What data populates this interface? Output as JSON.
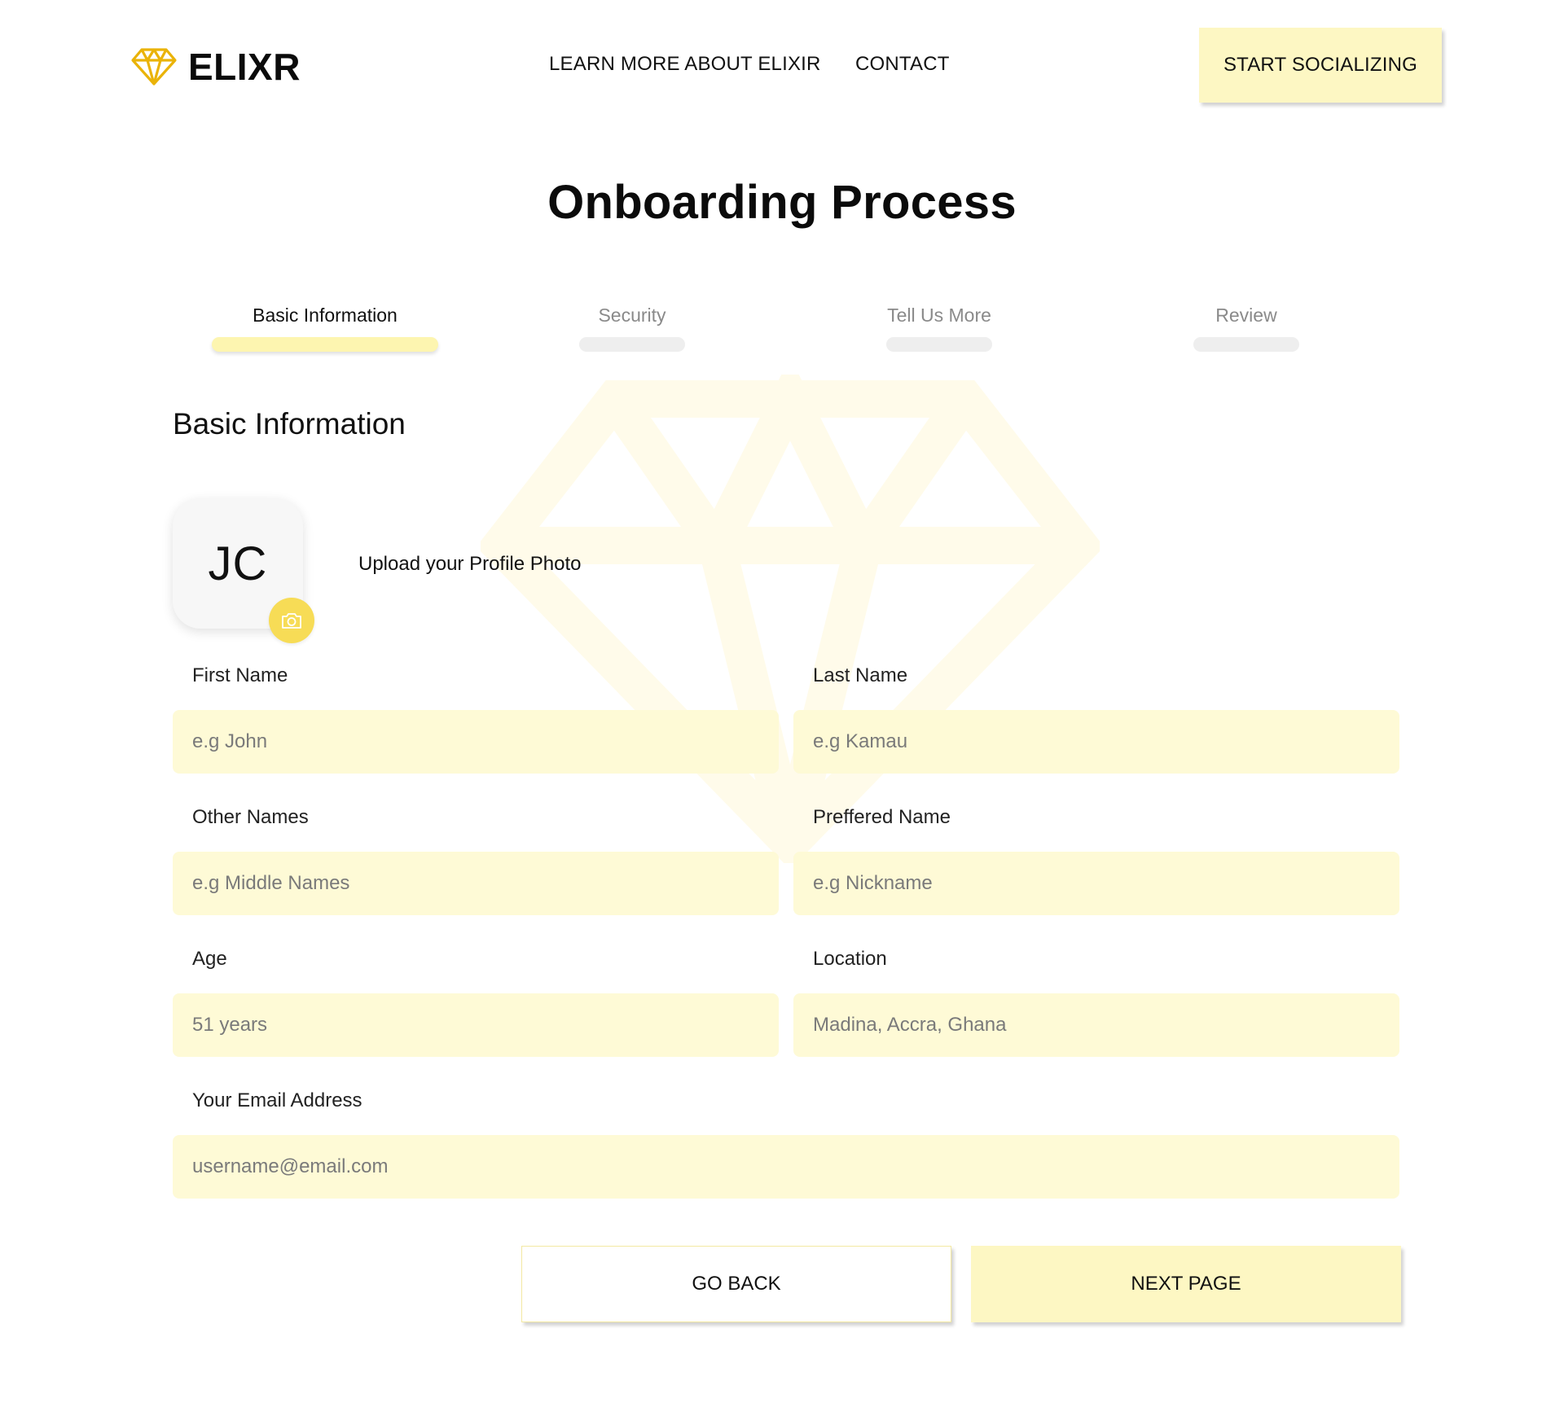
{
  "header": {
    "brand": "ELIXR",
    "brand_icon": "diamond-icon",
    "nav": {
      "learn_more": "LEARN MORE ABOUT ELIXIR",
      "contact": "CONTACT"
    },
    "cta": "START SOCIALIZING"
  },
  "title": "Onboarding Process",
  "steps": [
    {
      "label": "Basic Information",
      "active": true
    },
    {
      "label": "Security",
      "active": false
    },
    {
      "label": "Tell Us More",
      "active": false
    },
    {
      "label": "Review",
      "active": false
    }
  ],
  "section": {
    "title": "Basic Information",
    "avatar_initials": "JC",
    "upload_label": "Upload your Profile Photo",
    "camera_icon": "camera-icon"
  },
  "form": {
    "first_name": {
      "label": "First Name",
      "placeholder": "e.g John"
    },
    "last_name": {
      "label": "Last Name",
      "placeholder": "e.g Kamau"
    },
    "other_names": {
      "label": "Other Names",
      "placeholder": "e.g Middle Names"
    },
    "preferred_name": {
      "label": "Preffered Name",
      "placeholder": "e.g Nickname"
    },
    "age": {
      "label": "Age",
      "placeholder": "51 years"
    },
    "location": {
      "label": "Location",
      "placeholder": "Madina, Accra, Ghana"
    },
    "email": {
      "label": "Your Email Address",
      "placeholder": "username@email.com"
    }
  },
  "actions": {
    "back": "GO BACK",
    "next": "NEXT PAGE"
  },
  "colors": {
    "accent": "#fdf7c3",
    "input_bg": "#fefad6",
    "brand_gold": "#eab308",
    "camera_bg": "#f7dc56",
    "inactive_bar": "#eeeeee"
  }
}
